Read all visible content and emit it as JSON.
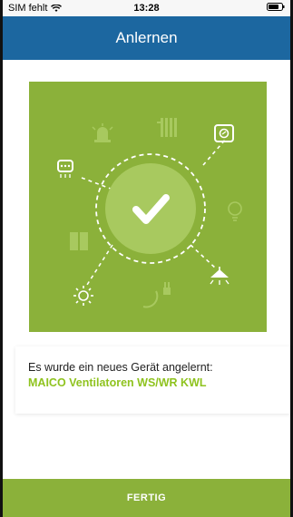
{
  "status_bar": {
    "carrier": "SIM fehlt",
    "time": "13:28",
    "icons": [
      "wifi-icon",
      "battery-icon"
    ]
  },
  "header": {
    "title": "Anlernen"
  },
  "hero": {
    "center_icon": "checkmark-icon",
    "device_icons": [
      "siren-icon",
      "radiator-icon",
      "switch-icon",
      "ventilator-icon",
      "bulb-icon",
      "blinds-icon",
      "light-icon",
      "plug-icon",
      "sun-icon"
    ],
    "colors": {
      "background": "#8bb13a",
      "circle": "#a8c95f",
      "icon": "#ffffff"
    }
  },
  "info": {
    "message": "Es wurde ein neues Gerät angelernt:",
    "device_name": "MAICO Ventilatoren WS/WR KWL"
  },
  "footer": {
    "button_label": "FERTIG"
  }
}
